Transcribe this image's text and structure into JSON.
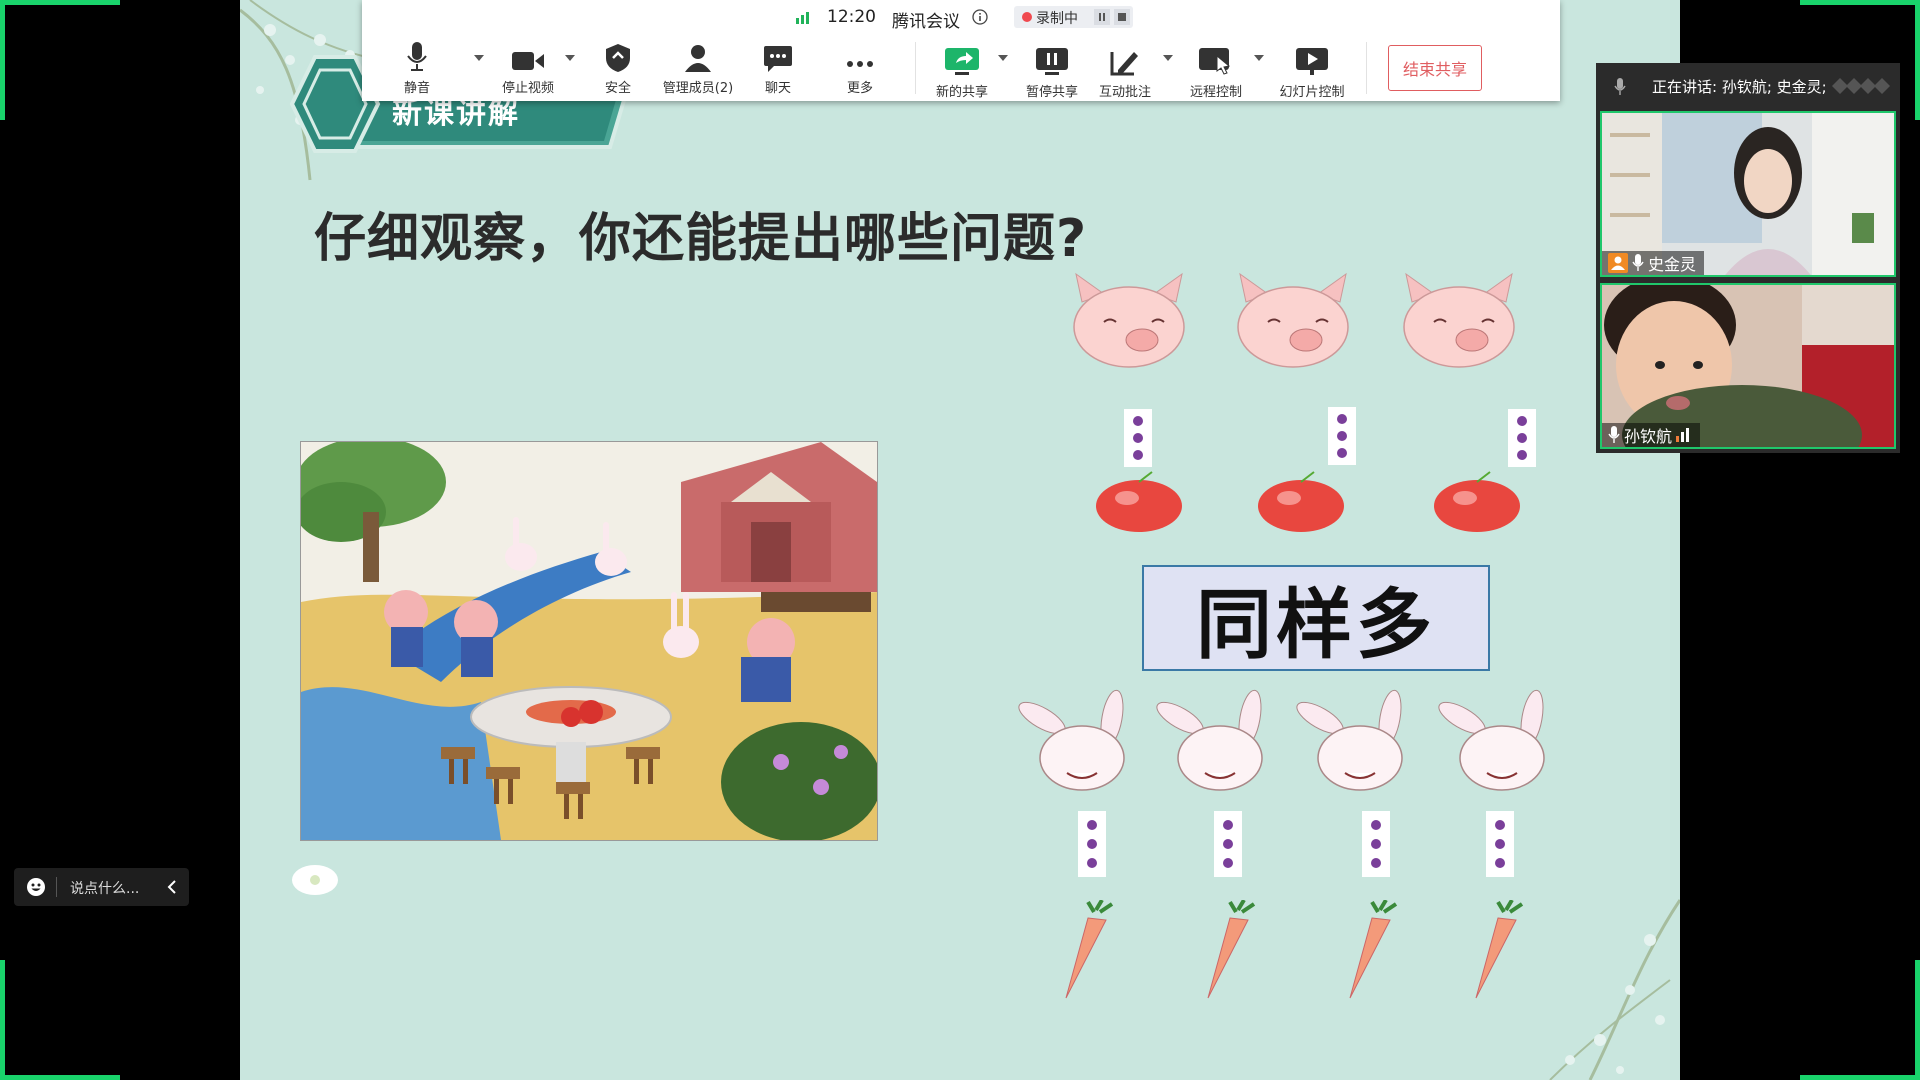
{
  "meeting": {
    "time": "12:20",
    "app_name": "腾讯会议",
    "recording_label": "录制中"
  },
  "toolbar": {
    "buttons": [
      {
        "label": "静音",
        "icon": "microphone-icon"
      },
      {
        "label": "停止视频",
        "icon": "video-camera-icon"
      },
      {
        "label": "安全",
        "icon": "shield-icon"
      },
      {
        "label": "管理成员(2)",
        "icon": "members-icon"
      },
      {
        "label": "聊天",
        "icon": "chat-icon"
      },
      {
        "label": "更多",
        "icon": "more-icon"
      },
      {
        "label": "新的共享",
        "icon": "share-screen-icon"
      },
      {
        "label": "暂停共享",
        "icon": "pause-share-icon"
      },
      {
        "label": "互动批注",
        "icon": "annotate-icon"
      },
      {
        "label": "远程控制",
        "icon": "remote-control-icon"
      },
      {
        "label": "幻灯片控制",
        "icon": "slideshow-icon"
      }
    ],
    "end_share": "结束共享"
  },
  "slide": {
    "banner_label": "新课讲解",
    "question": "仔细观察，你还能提出哪些问题?",
    "answer": "同样多",
    "pigs_count": 3,
    "rabbits_count": 4
  },
  "participants": {
    "speaking_text": "正在讲话: 孙钦航; 史金灵;",
    "list": [
      {
        "name": "史金灵",
        "role": "host"
      },
      {
        "name": "孙钦航",
        "role": "member"
      }
    ]
  },
  "chat": {
    "placeholder": "说点什么..."
  },
  "colors": {
    "accent_green": "#19d36b",
    "slide_bg": "#c9e6de",
    "end_share_red": "#e05d60",
    "badge_teal": "#2f8a7c"
  }
}
